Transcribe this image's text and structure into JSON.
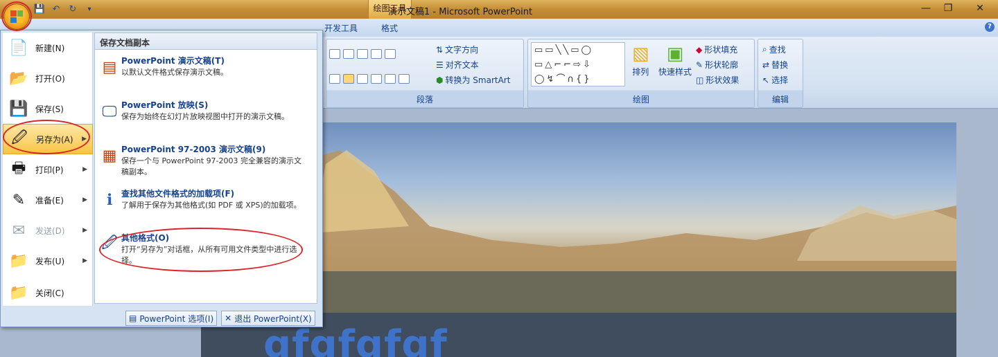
{
  "window": {
    "title": "演示文稿1 - Microsoft PowerPoint",
    "context_tab": "绘图工具",
    "minimize_glyph": "—",
    "restore_glyph": "❐",
    "close_glyph": "✕"
  },
  "qat": {
    "save": "💾",
    "undo": "↶",
    "redo": "↻",
    "customize": "▾"
  },
  "tabs": [
    {
      "label": "开发工具"
    },
    {
      "label": "格式"
    }
  ],
  "help_glyph": "?",
  "ribbon": {
    "paragraph": {
      "label": "段落",
      "text_direction": "文字方向",
      "align_text": "对齐文本",
      "convert_smartart": "转换为 SmartArt"
    },
    "drawing": {
      "label": "绘图",
      "arrange": "排列",
      "quick_styles": "快速样式",
      "shape_fill": "形状填充",
      "shape_outline": "形状轮廓",
      "shape_effects": "形状效果"
    },
    "editing": {
      "label": "编辑",
      "find": "查找",
      "replace": "替换",
      "select": "选择"
    }
  },
  "menu": {
    "items": [
      {
        "label": "新建(N)",
        "icon": "📄"
      },
      {
        "label": "打开(O)",
        "icon": "📂"
      },
      {
        "label": "保存(S)",
        "icon": "💾"
      },
      {
        "label": "另存为(A)",
        "icon": "🖉"
      },
      {
        "label": "打印(P)",
        "icon": "🖶"
      },
      {
        "label": "准备(E)",
        "icon": "✎"
      },
      {
        "label": "发送(D)",
        "icon": "✉"
      },
      {
        "label": "发布(U)",
        "icon": "📁"
      },
      {
        "label": "关闭(C)",
        "icon": "📁"
      }
    ],
    "submenu_header": "保存文档副本",
    "sub_items": [
      {
        "title": "PowerPoint 演示文稿(T)",
        "desc": "以默认文件格式保存演示文稿。"
      },
      {
        "title": "PowerPoint 放映(S)",
        "desc": "保存为始终在幻灯片放映视图中打开的演示文稿。"
      },
      {
        "title": "PowerPoint 97-2003 演示文稿(9)",
        "desc": "保存一个与 PowerPoint 97-2003 完全兼容的演示文稿副本。"
      },
      {
        "title": "查找其他文件格式的加载项(F)",
        "desc": "了解用于保存为其他格式(如 PDF 或 XPS)的加载项。"
      },
      {
        "title": "其他格式(O)",
        "desc": "打开“另存为”对话框，从所有可用文件类型中进行选择。"
      }
    ],
    "options_button": "PowerPoint 选项(I)",
    "exit_button": "退出 PowerPoint(X)"
  },
  "slide": {
    "text": "gfgfgfgf"
  },
  "colors": {
    "accent": "#15428b",
    "highlight": "#d8262a",
    "menu_selected": "#fcd677"
  }
}
